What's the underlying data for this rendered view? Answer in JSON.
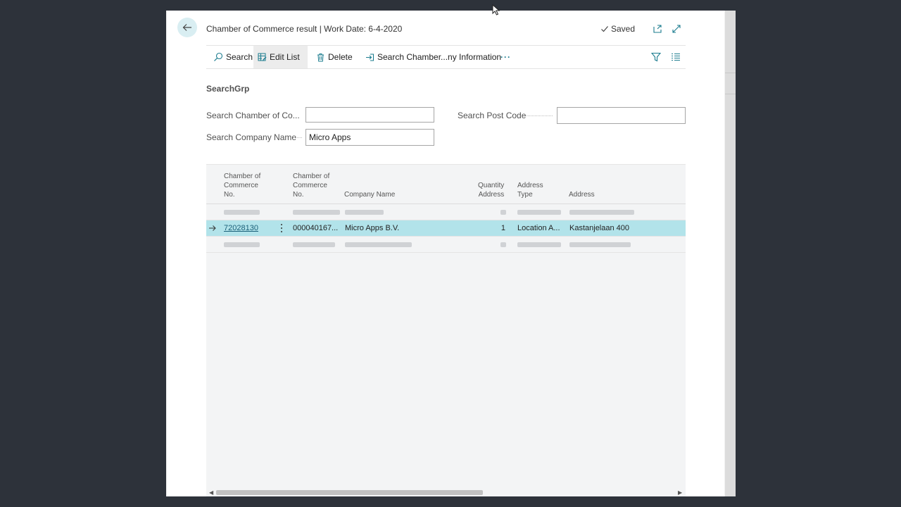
{
  "header": {
    "title": "Chamber of Commerce result | Work Date: 6-4-2020",
    "saved_label": "Saved"
  },
  "actions": {
    "search": "Search",
    "edit_list": "Edit List",
    "delete": "Delete",
    "search_info": "Search Chamber...ny Information",
    "more": "···"
  },
  "group": {
    "title": "SearchGrp",
    "fields": {
      "chamber_label": "Search Chamber of Co...",
      "chamber_value": "",
      "postcode_label": "Search Post Code",
      "postcode_value": "",
      "company_label": "Search Company Name",
      "company_value": "Micro Apps"
    }
  },
  "table": {
    "columns": {
      "col1_l1": "Chamber of",
      "col1_l2": "Commerce",
      "col1_l3": "No.",
      "col2_l1": "Chamber of",
      "col2_l2": "Commerce",
      "col2_l3": "No.",
      "col3": "Company Name",
      "col4_l1": "Quantity",
      "col4_l2": "Address",
      "col5_l1": "Address",
      "col5_l2": "Type",
      "col6": "Address"
    },
    "selected_row": {
      "chamber_no": "72028130",
      "chamber_no2": "000040167...",
      "company_name": "Micro Apps B.V.",
      "quantity": "1",
      "address_type": "Location A...",
      "address": "Kastanjelaan 400"
    }
  }
}
